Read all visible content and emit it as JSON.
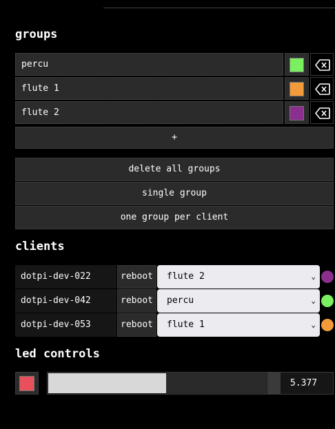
{
  "groups_section": {
    "title": "groups",
    "items": [
      {
        "name": "percu",
        "color": "#7aef5f"
      },
      {
        "name": "flute 1",
        "color": "#f39a3b"
      },
      {
        "name": "flute 2",
        "color": "#8b2f8f"
      }
    ],
    "add_label": "+",
    "delete_icon": "backspace-icon"
  },
  "group_actions": {
    "delete_all": "delete all groups",
    "single_group": "single group",
    "one_per_client": "one group per client"
  },
  "clients_section": {
    "title": "clients",
    "reboot_label": "reboot",
    "items": [
      {
        "name": "dotpi-dev-022",
        "group": "flute 2",
        "color": "#8b2f8f"
      },
      {
        "name": "dotpi-dev-042",
        "group": "percu",
        "color": "#7aef5f"
      },
      {
        "name": "dotpi-dev-053",
        "group": "flute 1",
        "color": "#f39a3b"
      }
    ]
  },
  "led_section": {
    "title": "led controls",
    "color": "#e8505b",
    "value": "5.377",
    "slider_fraction": 0.54
  }
}
